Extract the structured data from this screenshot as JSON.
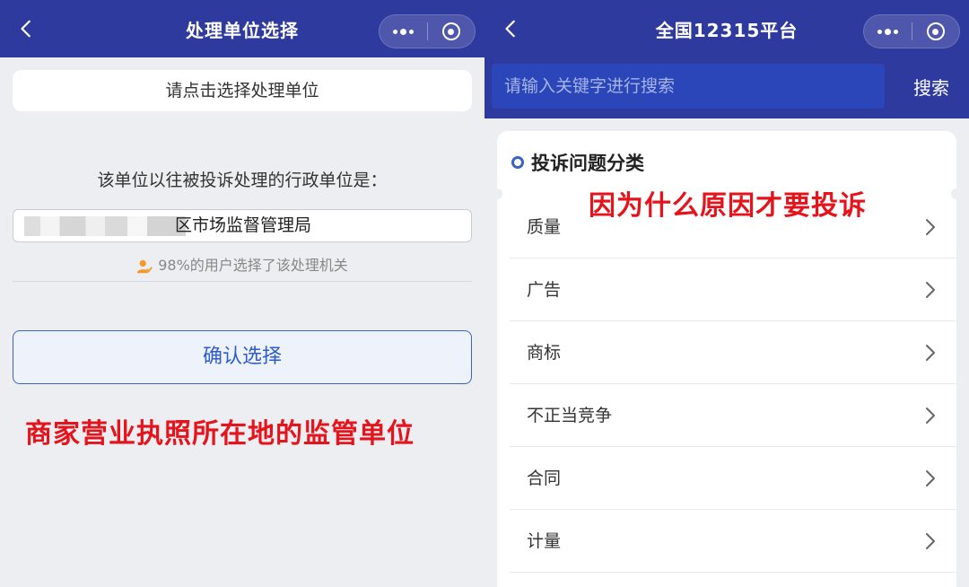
{
  "left": {
    "nav": {
      "title": "处理单位选择"
    },
    "select_placeholder": "请点击选择处理单位",
    "hint": "该单位以往被投诉处理的行政单位是：",
    "department_suffix": "区市场监督管理局",
    "percent_text": "98%的用户选择了该处理机关",
    "confirm_label": "确认选择",
    "annotation": "商家营业执照所在地的监管单位",
    "icons": [
      "back-icon",
      "more-dots-icon",
      "close-miniprogram-icon",
      "user-icon"
    ]
  },
  "right": {
    "nav": {
      "title": "全国12315平台"
    },
    "search_placeholder": "请输入关键字进行搜索",
    "search_label": "搜索",
    "section_title": "投诉问题分类",
    "annotation": "因为什么原因才要投诉",
    "categories": [
      "质量",
      "广告",
      "商标",
      "不正当竞争",
      "合同",
      "计量"
    ],
    "icons": [
      "back-icon",
      "more-dots-icon",
      "close-miniprogram-icon",
      "chevron-right-icon"
    ]
  },
  "colors": {
    "nav_bg": "#2f3a9e",
    "search_input_bg": "#2a46b8",
    "accent": "#2d5bd0",
    "annotation_red": "#e5141c",
    "page_bg": "#eceef2"
  }
}
